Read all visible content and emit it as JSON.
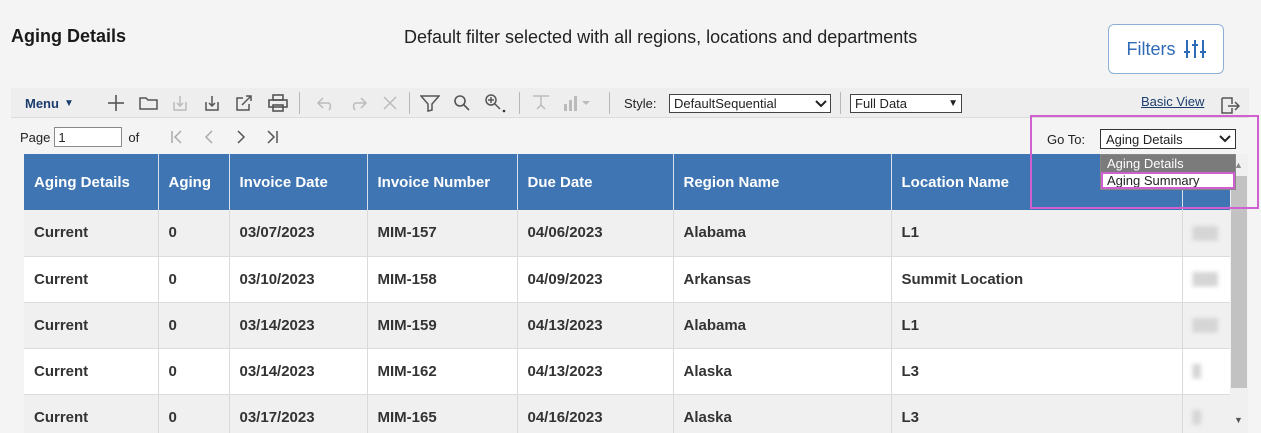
{
  "header": {
    "title": "Aging Details",
    "subtitle": "Default filter selected with all regions, locations and departments",
    "filters_label": "Filters"
  },
  "toolbar": {
    "menu_label": "Menu",
    "style_label": "Style:",
    "style_value": "DefaultSequential",
    "data_value": "Full Data",
    "basic_view_label": "Basic View",
    "icons": [
      "add-icon",
      "open-folder-icon",
      "import-icon",
      "export-icon",
      "share-icon",
      "print-icon",
      "undo-icon",
      "redo-icon",
      "delete-icon",
      "filter-icon",
      "search-icon",
      "zoom-icon",
      "drill-icon",
      "chart-icon",
      "exit-icon"
    ]
  },
  "pager": {
    "page_label": "Page",
    "page_value": "1",
    "of_label": "of"
  },
  "goto": {
    "label": "Go To:",
    "selected": "Aging Details",
    "options": [
      "Aging Details",
      "Aging Summary"
    ]
  },
  "table": {
    "columns": [
      "Aging Details",
      "Aging",
      "Invoice Date",
      "Invoice Number",
      "Due Date",
      "Region Name",
      "Location Name"
    ],
    "rows": [
      [
        "Current",
        "0",
        "03/07/2023",
        "MIM-157",
        "04/06/2023",
        "Alabama",
        "L1"
      ],
      [
        "Current",
        "0",
        "03/10/2023",
        "MIM-158",
        "04/09/2023",
        "Arkansas",
        "Summit Location"
      ],
      [
        "Current",
        "0",
        "03/14/2023",
        "MIM-159",
        "04/13/2023",
        "Alabama",
        "L1"
      ],
      [
        "Current",
        "0",
        "03/14/2023",
        "MIM-162",
        "04/13/2023",
        "Alaska",
        "L3"
      ],
      [
        "Current",
        "0",
        "03/17/2023",
        "MIM-165",
        "04/16/2023",
        "Alaska",
        "L3"
      ]
    ]
  },
  "colors": {
    "header_bg": "#3e75b2",
    "accent": "#2f6ab7",
    "highlight": "#d05fd0"
  }
}
